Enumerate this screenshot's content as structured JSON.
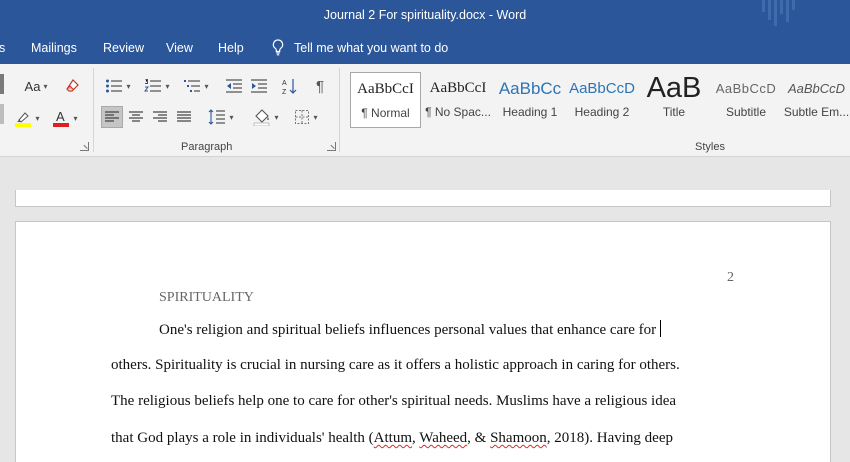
{
  "window": {
    "title": "Journal 2 For spirituality.docx  -  Word"
  },
  "ribbon_tabs": {
    "partial_left": "s",
    "mailings": "Mailings",
    "review": "Review",
    "view": "View",
    "help": "Help",
    "tell_me": "Tell me what you want to do"
  },
  "ribbon": {
    "font_group": {
      "change_case": "Aa",
      "highlight_icon": "highlighter-icon",
      "font_color_icon": "font-color-icon"
    },
    "paragraph_group": {
      "label": "Paragraph",
      "sort_icon": "sort-az-icon",
      "pilcrow": "¶"
    },
    "styles_group": {
      "label": "Styles",
      "items": [
        {
          "preview": "AaBbCcI",
          "name": "¶ Normal"
        },
        {
          "preview": "AaBbCcI",
          "name": "¶ No Spac..."
        },
        {
          "preview": "AaBbCc",
          "name": "Heading 1"
        },
        {
          "preview": "AaBbCcD",
          "name": "Heading 2"
        },
        {
          "preview": "AaB",
          "name": "Title"
        },
        {
          "preview": "AaBbCcD",
          "name": "Subtitle"
        },
        {
          "preview": "AaBbCcD",
          "name": "Subtle Em..."
        }
      ]
    }
  },
  "document": {
    "page_number": "2",
    "running_head": "SPIRITUALITY",
    "lines": [
      "One's religion and spiritual beliefs influences personal values that enhance care for",
      "others. Spirituality is crucial in nursing care as it offers a holistic approach in caring for others.",
      "The religious beliefs help one to care for other's spiritual needs. Muslims have a religious idea"
    ],
    "line4": {
      "before": "that God plays a role in individuals' health (",
      "cite_1": "Attum",
      "sep_1": ", ",
      "cite_2": "Waheed",
      "sep_2": ", & ",
      "cite_3": "Shamoon",
      "after": ", 2018). Having deep"
    }
  },
  "colors": {
    "accent": "#2b579a",
    "ribbon_bg": "#f3f3f3",
    "doc_bg": "#e6e6e6",
    "heading_blue": "#2e74b5",
    "font_red": "#e02020",
    "highlight_yellow": "#ffff00"
  }
}
